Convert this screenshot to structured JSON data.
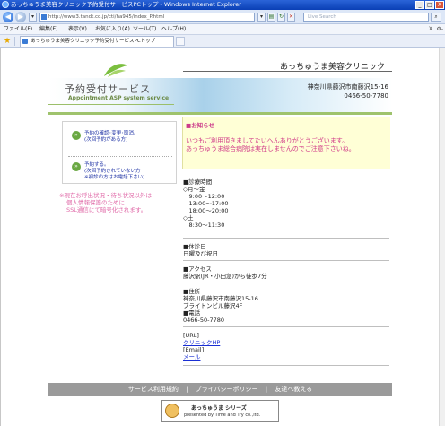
{
  "window": {
    "title": "あっちゅうま美容クリニック予約受付サービスPCトップ - Windows Internet Explorer",
    "controls": {
      "minimize": "_",
      "maximize": "□",
      "close": "X"
    }
  },
  "address_bar": {
    "url": "http://www3.tandt.co.jp/cti/ha945/index_P.html",
    "search_placeholder": "Live Search",
    "back": "◀",
    "forward": "▶"
  },
  "menu": {
    "items": [
      "ファイル(F)",
      "編集(E)",
      "表示(V)",
      "お気に入り(A)",
      "ツール(T)",
      "ヘルプ(H)"
    ],
    "close_x": "X",
    "settings": "⚙-"
  },
  "tab": {
    "title": "あっちゅうま美容クリニック予約受付サービスPCトップ"
  },
  "header": {
    "clinic_name": "あっちゅうま美容クリニック",
    "logo_jp": "予約受付サービス",
    "logo_en": "Appointment ASP system service",
    "address": "神奈川県藤沢市南藤沢15-16",
    "phone": "0466-50-7780"
  },
  "left_menu": {
    "link1_line1": "予約の確認･変更･取消。",
    "link1_line2": "(次回予約がある方)",
    "link2_line1": "予約する。",
    "link2_line2": "(次回予約されていない方",
    "link2_line3": "※初診の方はお電話下さい)",
    "note_lines": [
      "※現在お呼出状況・待ち状況以外は",
      "個人情報保護のために",
      "SSL通信にて暗号化されます。"
    ]
  },
  "news": {
    "title": "■お知らせ",
    "lines": [
      "いつもご利用頂きましてたいへんありがとうございます。",
      "あっちゅうま総合病院は実在しませんのでご注意下さいね。"
    ]
  },
  "info": {
    "hours_lines": [
      "■診療時間",
      "◇月～金",
      "　9:00～12:00",
      "　13:00～17:00",
      "　18:00～20:00",
      "◇土",
      "　8:30～11:30"
    ],
    "holiday_lines": [
      "■休診日",
      "日曜及び祝日"
    ],
    "access_lines": [
      "■アクセス",
      "藤沢駅(JR・小田急)から徒歩7分"
    ],
    "address_lines": [
      "■住所",
      "神奈川県藤沢市南藤沢15-16",
      "ブライトンビル藤沢4F",
      "■電話",
      "0466-50-7780"
    ],
    "url_label": "[URL]",
    "url_link": "クリニックHP",
    "email_label": "[Email]",
    "email_link": "メール"
  },
  "footer": {
    "links": [
      "サービス利用規約",
      "プライバシーポリシー",
      "友達へ教える"
    ],
    "divider": "|",
    "logo_line1": "あっちゅうま シリーズ",
    "logo_line2": "presented by Time and Try co.,ltd."
  },
  "colors": {
    "accent_green": "#9fc36d",
    "news_bg": "#ffffd6",
    "news_text": "#d13a88",
    "link_blue": "#1a2fd4"
  }
}
